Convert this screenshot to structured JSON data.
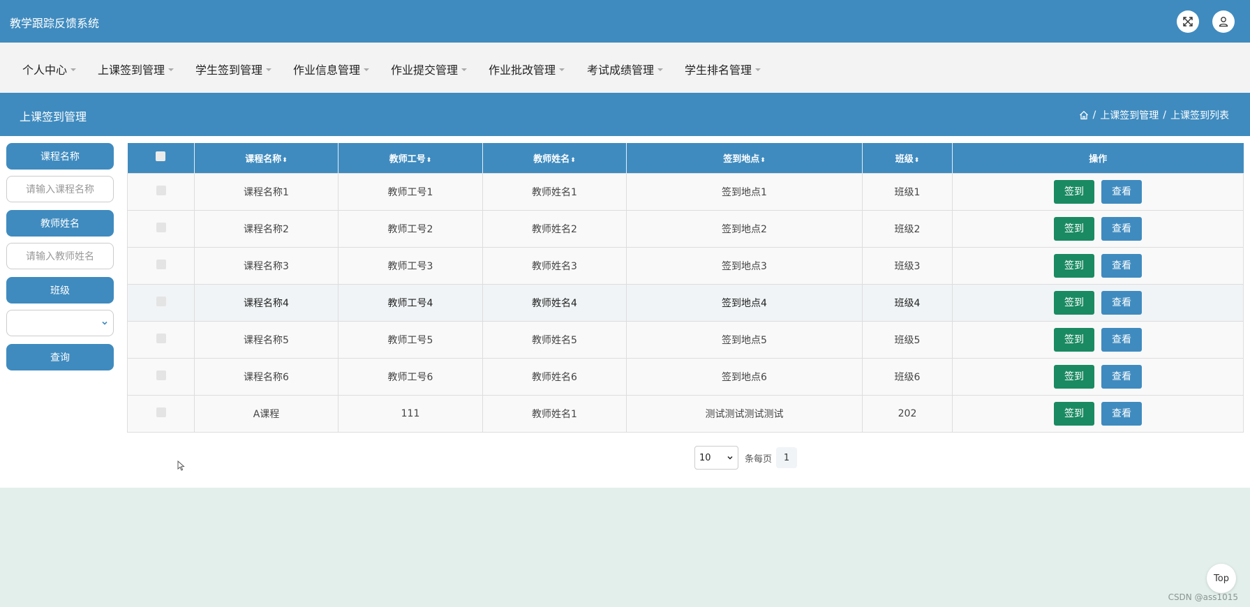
{
  "app": {
    "title": "教学跟踪反馈系统"
  },
  "header_icons": [
    {
      "name": "fullscreen-icon"
    },
    {
      "name": "user-icon"
    }
  ],
  "nav": {
    "items": [
      {
        "label": "个人中心"
      },
      {
        "label": "上课签到管理"
      },
      {
        "label": "学生签到管理"
      },
      {
        "label": "作业信息管理"
      },
      {
        "label": "作业提交管理"
      },
      {
        "label": "作业批改管理"
      },
      {
        "label": "考试成绩管理"
      },
      {
        "label": "学生排名管理"
      }
    ]
  },
  "section": {
    "title": "上课签到管理",
    "breadcrumb": [
      "上课签到管理",
      "上课签到列表"
    ],
    "breadcrumb_separator": "/"
  },
  "search": {
    "course_label": "课程名称",
    "course_placeholder": "请输入课程名称",
    "teacher_label": "教师姓名",
    "teacher_placeholder": "请输入教师姓名",
    "class_label": "班级",
    "class_value": "",
    "query_button": "查询"
  },
  "table": {
    "columns": [
      "课程名称",
      "教师工号",
      "教师姓名",
      "签到地点",
      "班级",
      "操作"
    ],
    "sort_glyph": "⬍",
    "rows": [
      {
        "course": "课程名称1",
        "teacher_id": "教师工号1",
        "teacher_name": "教师姓名1",
        "location": "签到地点1",
        "class": "班级1"
      },
      {
        "course": "课程名称2",
        "teacher_id": "教师工号2",
        "teacher_name": "教师姓名2",
        "location": "签到地点2",
        "class": "班级2"
      },
      {
        "course": "课程名称3",
        "teacher_id": "教师工号3",
        "teacher_name": "教师姓名3",
        "location": "签到地点3",
        "class": "班级3"
      },
      {
        "course": "课程名称4",
        "teacher_id": "教师工号4",
        "teacher_name": "教师姓名4",
        "location": "签到地点4",
        "class": "班级4"
      },
      {
        "course": "课程名称5",
        "teacher_id": "教师工号5",
        "teacher_name": "教师姓名5",
        "location": "签到地点5",
        "class": "班级5"
      },
      {
        "course": "课程名称6",
        "teacher_id": "教师工号6",
        "teacher_name": "教师姓名6",
        "location": "签到地点6",
        "class": "班级6"
      },
      {
        "course": "A课程",
        "teacher_id": "111",
        "teacher_name": "教师姓名1",
        "location": "测试测试测试测试",
        "class": "202"
      }
    ],
    "sign_button": "签到",
    "view_button": "查看"
  },
  "pagination": {
    "page_size": "10",
    "page_size_label": "条每页",
    "current_page": "1"
  },
  "top_button": "Top",
  "watermark": "CSDN @ass1015",
  "colors": {
    "primary": "#3f8bbf",
    "sign_button": "#1a8a62",
    "nav_bg": "#f3f3f3",
    "footer_bg": "#e3efeb"
  }
}
